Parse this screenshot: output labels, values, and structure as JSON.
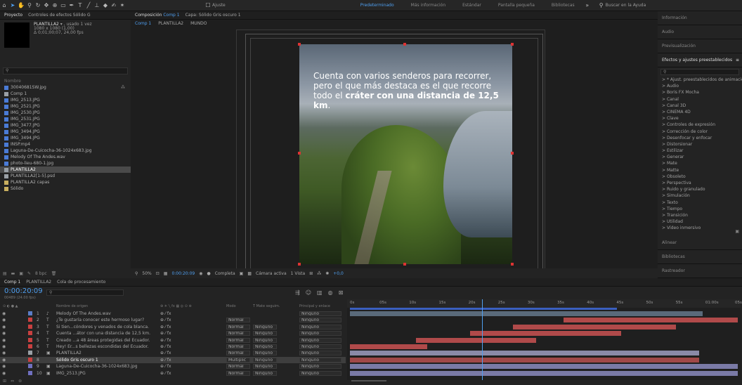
{
  "toolbar": {
    "search_checkbox": "Ajuste",
    "workspaces": [
      "Predeterminado",
      "Más información",
      "Estándar",
      "Pantalla pequeña",
      "Bibliotecas"
    ],
    "search_placeholder": "Buscar en la Ayuda"
  },
  "project": {
    "tabs": [
      "Proyecto",
      "Controles de efectos Sólido G"
    ],
    "preview_name": "PLANTILLA2",
    "preview_used": "usado 1 vez",
    "preview_size": "1080 x 1080 (1,00)",
    "preview_duration": "Δ 0;01;00;07, 24,00 fps",
    "column_header": "Nombre",
    "items": [
      {
        "name": "30040681SW.jpg",
        "color": "#4a7bd6"
      },
      {
        "name": "Comp 1",
        "color": "#9aa0a6"
      },
      {
        "name": "IMG_2513.JPG",
        "color": "#4a7bd6"
      },
      {
        "name": "IMG_2521.JPG",
        "color": "#4a7bd6"
      },
      {
        "name": "IMG_2530.JPG",
        "color": "#4a7bd6"
      },
      {
        "name": "IMG_2531.JPG",
        "color": "#4a7bd6"
      },
      {
        "name": "IMG_3477.JPG",
        "color": "#4a7bd6"
      },
      {
        "name": "IMG_3494.JPG",
        "color": "#4a7bd6"
      },
      {
        "name": "IMG_3494.JPG",
        "color": "#4a7bd6"
      },
      {
        "name": "INSP.mp4",
        "color": "#4a7bd6"
      },
      {
        "name": "Laguna-De-Cuicocha-36-1024x683.jpg",
        "color": "#4a7bd6"
      },
      {
        "name": "Melody Of The Andes.wav",
        "color": "#4a7bd6"
      },
      {
        "name": "photo-lieu-680-1.jpg",
        "color": "#4a7bd6"
      },
      {
        "name": "PLANTILLA2",
        "color": "#9aa0a6"
      },
      {
        "name": "PLANTILLA2[1-5].psd",
        "color": "#9aa0a6"
      },
      {
        "name": "PLANTILLA2 capas",
        "color": "#c9b060"
      },
      {
        "name": "Sólido",
        "color": "#c9b060"
      }
    ],
    "footer_bpc": "8 bpc"
  },
  "viewer": {
    "tab_label": "Composición",
    "tab_name": "Comp 1",
    "tab2": "Capa: Sólido Gris oscuro 1",
    "breadcrumbs": [
      "Comp 1",
      "PLANTILLA2",
      "MUNDO"
    ],
    "overlay_text_1": "Cuenta con varios senderos para recorrer, pero el que más destaca es el que recorre todo el",
    "overlay_bold_1": "cráter",
    "overlay_bold_2": "con una distancia de 12,5 km",
    "overlay_end": ".",
    "zoom": "50%",
    "timecode": "0:00:20:09",
    "quality": "Completa",
    "camera": "Cámara activa",
    "views": "1 Vista",
    "exposure": "+0,0"
  },
  "right": {
    "sections": [
      "Información",
      "Audio",
      "Previsualización"
    ],
    "effects_title": "Efectos y ajustes preestablecidos",
    "effects": [
      "* Ajust. preestablecidos de animación",
      "Audio",
      "Boris FX Mocha",
      "Canal",
      "Canal 3D",
      "CINEMA 4D",
      "Clave",
      "Controles de expresión",
      "Corrección de color",
      "Desenfocar y enfocar",
      "Distorsionar",
      "Estilizar",
      "Generar",
      "Mate",
      "Matte",
      "Obsoleto",
      "Perspectiva",
      "Ruido y granulado",
      "Simulación",
      "Texto",
      "Tiempo",
      "Transición",
      "Utilidad",
      "Vídeo inmersivo"
    ],
    "bottom_sections": [
      "Alinear",
      "Bibliotecas",
      "Rastreador"
    ]
  },
  "timeline": {
    "tabs": [
      "Comp 1",
      "PLANTILLA2",
      "Cola de procesamiento"
    ],
    "timecode": "0:00:20:09",
    "timecode_sub": "00489 (24.00 fps)",
    "columns": {
      "name": "Nombre de origen",
      "mode": "Modo",
      "track": "T  Mate seguim.",
      "parent": "Principal y enlace"
    },
    "ruler": [
      "0s",
      "05s",
      "10s",
      "15s",
      "20s",
      "25s",
      "30s",
      "35s",
      "40s",
      "45s",
      "50s",
      "55s",
      "01:00s",
      "05s"
    ],
    "layers": [
      {
        "num": "1",
        "type": "♪",
        "name": "Melody Of The Andes.wav",
        "label": "#5a7cc6",
        "mode": "",
        "track": "",
        "parent": "Ninguno"
      },
      {
        "num": "2",
        "type": "T",
        "name": "¿Te gustaría conocer este hermoso lugar?",
        "label": "#c94040",
        "mode": "Normal",
        "track": "",
        "parent": "Ninguno"
      },
      {
        "num": "3",
        "type": "T",
        "name": "Si tien...cóndores y venados de cola blanca.",
        "label": "#c94040",
        "mode": "Normal",
        "track": "Ninguno",
        "parent": "Ninguno"
      },
      {
        "num": "4",
        "type": "T",
        "name": "Cuenta ...átor con una distancia de 12,5 km.",
        "label": "#c94040",
        "mode": "Normal",
        "track": "Ninguno",
        "parent": "Ninguno"
      },
      {
        "num": "5",
        "type": "T",
        "name": "Creado ...a 48 áreas protegidas del Ecuador.",
        "label": "#c94040",
        "mode": "Normal",
        "track": "Ninguno",
        "parent": "Ninguno"
      },
      {
        "num": "6",
        "type": "T",
        "name": "Hey! Er...s bellezas escondidas del Ecuador.",
        "label": "#c94040",
        "mode": "Normal",
        "track": "Ninguno",
        "parent": "Ninguno"
      },
      {
        "num": "7",
        "type": "▣",
        "name": "PLANTILLA2",
        "label": "#9aa0a6",
        "mode": "Normal",
        "track": "Ninguno",
        "parent": "Ninguno"
      },
      {
        "num": "8",
        "type": "",
        "name": "Sólido Gris oscuro 1",
        "label": "#c94040",
        "mode": "Multiplic",
        "track": "Ninguno",
        "parent": "Ninguno"
      },
      {
        "num": "9",
        "type": "▣",
        "name": "Laguna-De-Cuicocha-36-1024x683.jpg",
        "label": "#7070c0",
        "mode": "Normal",
        "track": "Ninguno",
        "parent": "Ninguno"
      },
      {
        "num": "10",
        "type": "▣",
        "name": "IMG_2513.JPG",
        "label": "#7070c0",
        "mode": "Normal",
        "track": "Ninguno",
        "parent": "Ninguno"
      }
    ],
    "playhead_fraction": 0.34
  }
}
